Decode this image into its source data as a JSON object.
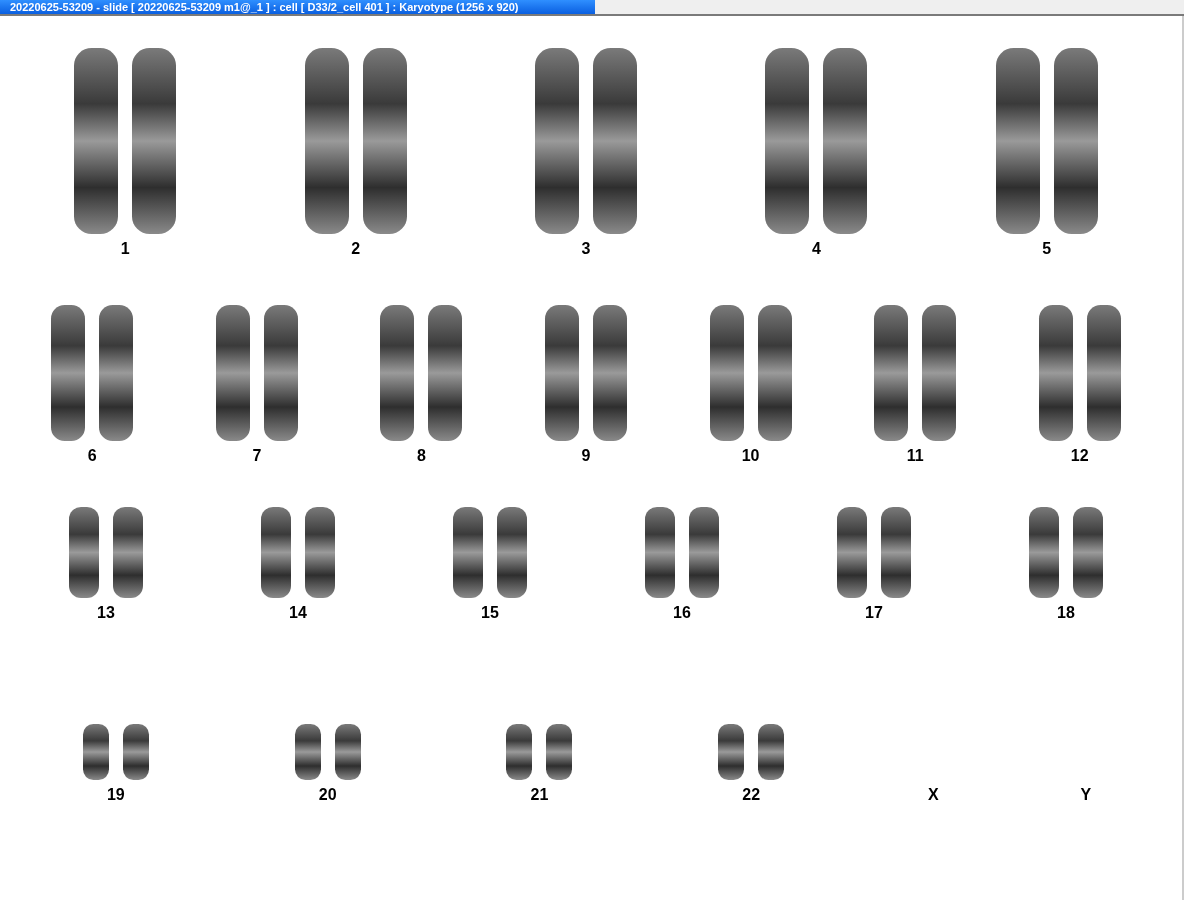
{
  "window": {
    "title": "20220625-53209 - slide [ 20220625-53209 m1@_1 ] : cell [ D33/2_cell 401 ] : Karyotype  (1256 x 920)"
  },
  "rows": [
    {
      "groups": [
        {
          "label": "1",
          "kind": "pair"
        },
        {
          "label": "2",
          "kind": "pair"
        },
        {
          "label": "3",
          "kind": "pair"
        },
        {
          "label": "4",
          "kind": "pair"
        },
        {
          "label": "5",
          "kind": "pair"
        }
      ]
    },
    {
      "groups": [
        {
          "label": "6",
          "kind": "pair"
        },
        {
          "label": "7",
          "kind": "pair"
        },
        {
          "label": "8",
          "kind": "pair"
        },
        {
          "label": "9",
          "kind": "pair"
        },
        {
          "label": "10",
          "kind": "pair"
        },
        {
          "label": "11",
          "kind": "pair"
        },
        {
          "label": "12",
          "kind": "pair"
        }
      ]
    },
    {
      "groups": [
        {
          "label": "13",
          "kind": "pair"
        },
        {
          "label": "14",
          "kind": "pair"
        },
        {
          "label": "15",
          "kind": "pair"
        },
        {
          "label": "16",
          "kind": "pair"
        },
        {
          "label": "17",
          "kind": "pair"
        },
        {
          "label": "18",
          "kind": "pair"
        }
      ]
    },
    {
      "groups": [
        {
          "label": "19",
          "kind": "pair"
        },
        {
          "label": "20",
          "kind": "pair"
        },
        {
          "label": "21",
          "kind": "pair"
        },
        {
          "label": "22",
          "kind": "pair"
        },
        {
          "label": "X",
          "kind": "empty"
        },
        {
          "label": "Y",
          "kind": "empty"
        }
      ]
    }
  ]
}
